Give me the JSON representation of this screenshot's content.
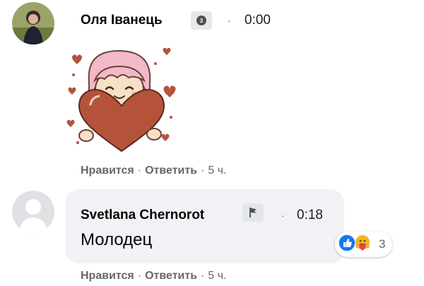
{
  "comments": [
    {
      "author": "Оля Іванець",
      "badge_icon": "profile-badge-icon",
      "time": "0:00",
      "sticker": "girl-holding-heart-sticker",
      "actions": {
        "like": "Нравится",
        "reply": "Ответить",
        "age": "5 ч."
      }
    },
    {
      "author": "Svetlana Chernorot",
      "badge_icon": "flag-icon",
      "time": "0:18",
      "text": "Молодец",
      "reactions": {
        "icons": [
          "like-reaction-icon",
          "care-reaction-icon"
        ],
        "count": "3"
      },
      "actions": {
        "like": "Нравится",
        "reply": "Ответить",
        "age": "5 ч."
      }
    }
  ],
  "colors": {
    "accent_dot": "#e41e3f",
    "bubble_bg": "#f0f2f5",
    "meta_text": "#65676b",
    "like_blue": "#1877f2",
    "heart_brown": "#b5533a"
  },
  "separator": "·"
}
